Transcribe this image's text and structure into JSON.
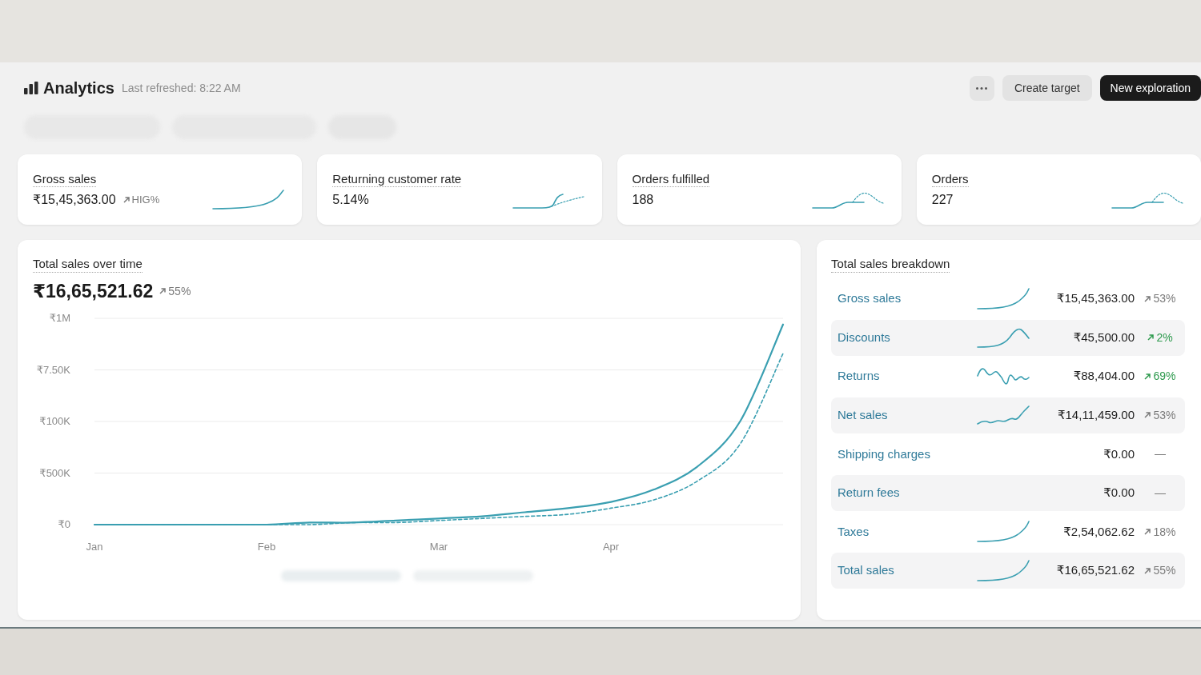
{
  "header": {
    "title": "Analytics",
    "subtitle": "Last refreshed: 8:22 AM",
    "buttons": [
      {
        "kind": "more"
      },
      {
        "kind": "secondary",
        "label": "Create target"
      },
      {
        "kind": "primary",
        "label": "New exploration"
      }
    ]
  },
  "metrics": [
    {
      "label": "Gross sales",
      "value": "₹15,45,363.00",
      "change": "HIG%"
    },
    {
      "label": "Returning customer rate",
      "value": "5.14%"
    },
    {
      "label": "Orders fulfilled",
      "value": "188"
    },
    {
      "label": "Orders",
      "value": "227"
    }
  ],
  "sales_over_time": {
    "title": "Total sales over time",
    "total": "₹16,65,521.62",
    "change": "55%",
    "y_axis_inner_labels": [
      "₹7.50K",
      "₹100K",
      "₹500K"
    ],
    "chart_data": {
      "type": "line",
      "categories": [
        "Jan",
        null,
        null,
        null,
        "Feb",
        null,
        null,
        null,
        "Mar",
        null,
        null,
        null,
        "Apr",
        null,
        null,
        null,
        null
      ],
      "ylim": [
        0,
        1000000
      ],
      "yticks": [
        {
          "value": 1000000,
          "label": "₹1M"
        },
        {
          "value": 0,
          "label": "₹0"
        }
      ],
      "series": [
        {
          "color": "#3a9fb1",
          "line_style": "solid",
          "values": [
            0,
            0,
            0,
            0,
            0,
            10000,
            10000,
            20000,
            30000,
            40000,
            60000,
            80000,
            110000,
            170000,
            280000,
            500000,
            970000
          ]
        },
        {
          "color": "#3a9fb1",
          "line_style": "dashed",
          "values": [
            0,
            0,
            0,
            0,
            0,
            0,
            10000,
            10000,
            20000,
            30000,
            40000,
            50000,
            80000,
            120000,
            210000,
            390000,
            830000
          ]
        }
      ]
    }
  },
  "breakdown": {
    "title": "Total sales breakdown",
    "rows": [
      {
        "kind": "trend",
        "label": "Gross sales",
        "amount": "₹15,45,363.00",
        "change": {
          "text": "53%",
          "arrow": true,
          "color": "#7a7a7a"
        }
      },
      {
        "kind": "trend",
        "label": "Discounts",
        "amount": "₹45,500.00",
        "change": {
          "text": "2%",
          "arrow": true,
          "color": "#2e9a4e"
        }
      },
      {
        "kind": "trend",
        "label": "Returns",
        "amount": "₹88,404.00",
        "change": {
          "text": "69%",
          "arrow": true,
          "color": "#2e9a4e"
        }
      },
      {
        "kind": "trend",
        "label": "Net sales",
        "amount": "₹14,11,459.00",
        "change": {
          "text": "53%",
          "arrow": true,
          "color": "#7a7a7a"
        }
      },
      {
        "kind": "plain",
        "label": "Shipping charges",
        "amount": "₹0.00",
        "change": {
          "text": "—",
          "arrow": false,
          "color": "#7a7a7a"
        }
      },
      {
        "kind": "plain",
        "label": "Return fees",
        "amount": "₹0.00",
        "change": {
          "text": "—",
          "arrow": false,
          "color": "#7a7a7a"
        }
      },
      {
        "kind": "trend",
        "label": "Taxes",
        "amount": "₹2,54,062.62",
        "change": {
          "text": "18%",
          "arrow": true,
          "color": "#7a7a7a"
        }
      },
      {
        "kind": "trend",
        "label": "Total sales",
        "amount": "₹16,65,521.62",
        "change": {
          "text": "55%",
          "arrow": true,
          "color": "#7a7a7a"
        }
      }
    ]
  }
}
